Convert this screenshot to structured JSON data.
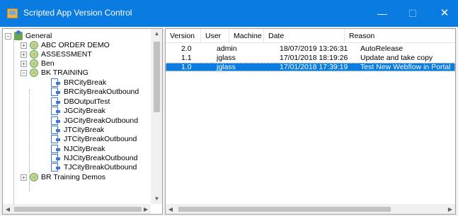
{
  "window": {
    "title": "Scripted App Version Control",
    "minimize_glyph": "—",
    "maximize_glyph": "☐",
    "close_glyph": "✕",
    "accent_color": "#0a7be0"
  },
  "tree": {
    "root": {
      "label": "General",
      "icon": "group-icon",
      "expander": "−"
    },
    "nodes": [
      {
        "label": "ABC ORDER DEMO",
        "icon": "folder-icon",
        "expander": "+"
      },
      {
        "label": "ASSESSMENT",
        "icon": "folder-icon",
        "expander": "+"
      },
      {
        "label": "Ben",
        "icon": "folder-icon",
        "expander": "+"
      },
      {
        "label": "BK TRAINING",
        "icon": "folder-icon",
        "expander": "−"
      }
    ],
    "children": [
      {
        "label": "BRCityBreak",
        "icon": "script-icon"
      },
      {
        "label": "BRCityBreakOutbound",
        "icon": "script-icon"
      },
      {
        "label": "DBOutputTest",
        "icon": "script-icon"
      },
      {
        "label": "JGCityBreak",
        "icon": "script-icon"
      },
      {
        "label": "JGCityBreakOutbound",
        "icon": "script-icon"
      },
      {
        "label": "JTCityBreak",
        "icon": "script-icon"
      },
      {
        "label": "JTCityBreakOutbound",
        "icon": "script-icon"
      },
      {
        "label": "NJCityBreak",
        "icon": "script-icon"
      },
      {
        "label": "NJCityBreakOutbound",
        "icon": "script-icon"
      },
      {
        "label": "TJCityBreakOutbound",
        "icon": "script-icon"
      }
    ],
    "last_node": {
      "label": "BR Training Demos",
      "icon": "folder-icon",
      "expander": "+"
    }
  },
  "list": {
    "columns": [
      "Version",
      "User",
      "Machine",
      "Date",
      "Reason"
    ],
    "rows": [
      {
        "version": "2.0",
        "user": "admin",
        "machine": "",
        "date": "18/07/2019 13:26:31",
        "reason": "AutoRelease",
        "selected": false
      },
      {
        "version": "1.1",
        "user": "jglass",
        "machine": "",
        "date": "17/01/2018 18:19:26",
        "reason": "Update and take copy",
        "selected": false
      },
      {
        "version": "1.0",
        "user": "jglass",
        "machine": "",
        "date": "17/01/2018 17:39:19",
        "reason": "Test New Webflow in Portal",
        "selected": true
      }
    ]
  },
  "scrollbars": {
    "up_glyph": "▲",
    "down_glyph": "▼",
    "left_glyph": "◀",
    "right_glyph": "▶"
  }
}
